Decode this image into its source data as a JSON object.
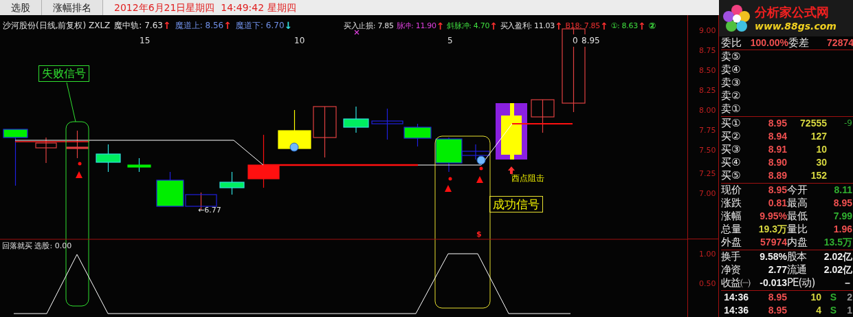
{
  "top_bar": {
    "tabs": [
      {
        "label": "选股",
        "selected": false
      },
      {
        "label": "涨幅排名",
        "selected": false
      }
    ],
    "datetime": "2012年6月21日星期四  14:49:42 星期四"
  },
  "logo": {
    "title": "分析家公式网",
    "url": "www.88gs.com"
  },
  "chart": {
    "header_left": [
      {
        "label": "沙河股份(日线,前复权) ZXLZ",
        "color": "#e0e0e0"
      },
      {
        "label": "魔中轨:",
        "value": "7.63",
        "color": "#e0e0e0",
        "arrow": {
          "text": "↑",
          "color": "#ff3030"
        }
      },
      {
        "label": "魔道上:",
        "value": "8.56",
        "color": "#7090e8",
        "arrow": {
          "text": "↑",
          "color": "#ff3030"
        }
      },
      {
        "label": "魔道下:",
        "value": "6.70",
        "color": "#7090e8",
        "arrow": {
          "text": "↓",
          "color": "#30e0e0"
        }
      }
    ],
    "header_right": [
      {
        "label": "买入止损:",
        "value": "7.85",
        "color": "#e0e0e0"
      },
      {
        "label": "脉冲:",
        "value": "11.90",
        "color": "#e040e0",
        "arrow": {
          "text": "↑",
          "color": "#ff3030"
        }
      },
      {
        "label": "斜脉冲:",
        "value": "4.70",
        "color": "#40e040",
        "arrow": {
          "text": "↑",
          "color": "#ff3030"
        }
      },
      {
        "label": "买入盈利:",
        "value": "11.03",
        "color": "#e0e0e0",
        "arrow": {
          "text": "↑",
          "color": "#ff3030"
        }
      },
      {
        "label": "B18:",
        "value": "7.85",
        "color": "#f03030",
        "arrow": {
          "text": "↑",
          "color": "#ff3030"
        }
      },
      {
        "label": "①:",
        "value": "8.63",
        "color": "#40e040",
        "arrow": {
          "text": "↑",
          "color": "#ff3030"
        }
      },
      {
        "label": "②",
        "color": "#40e040"
      }
    ],
    "x_labels": [
      "15",
      "10",
      "5",
      "0"
    ],
    "last_price": "8.95",
    "low_label": "←6.77",
    "fail_signal": "失败信号",
    "success_signal": "成功信号",
    "resistance_label": "西点阻击",
    "sell_mark": "$",
    "price_axis": [
      "9.00",
      "8.75",
      "8.50",
      "8.25",
      "8.00",
      "7.75",
      "7.50",
      "7.25",
      "7.00"
    ],
    "indicator_title": "回落就买 选股: 0.00",
    "indicator_axis": [
      "1.00",
      "0.50"
    ]
  },
  "quote_panel": {
    "order_ratio": [
      {
        "label": "委比",
        "value": "100.00%",
        "color": "#f05050"
      },
      {
        "label": "委差",
        "value": "72874",
        "color": "#f05050"
      }
    ],
    "asks": [
      {
        "label": "卖⑤"
      },
      {
        "label": "卖④"
      },
      {
        "label": "卖③"
      },
      {
        "label": "卖②"
      },
      {
        "label": "卖①"
      }
    ],
    "bids": [
      {
        "label": "买①",
        "price": "8.95",
        "volume": "72555",
        "change": "-9"
      },
      {
        "label": "买②",
        "price": "8.94",
        "volume": "127"
      },
      {
        "label": "买③",
        "price": "8.91",
        "volume": "10"
      },
      {
        "label": "买④",
        "price": "8.90",
        "volume": "30"
      },
      {
        "label": "买⑤",
        "price": "8.89",
        "volume": "152"
      }
    ],
    "quote_rows": [
      [
        {
          "label": "现价",
          "value": "8.95",
          "color": "#f05050"
        },
        {
          "label": "今开",
          "value": "8.11",
          "color": "#30b030"
        }
      ],
      [
        {
          "label": "涨跌",
          "value": "0.81",
          "color": "#f05050"
        },
        {
          "label": "最高",
          "value": "8.95",
          "color": "#f05050"
        }
      ],
      [
        {
          "label": "涨幅",
          "value": "9.95%",
          "color": "#f05050"
        },
        {
          "label": "最低",
          "value": "7.99",
          "color": "#30b030"
        }
      ],
      [
        {
          "label": "总量",
          "value": "19.3万",
          "color": "#d8d840"
        },
        {
          "label": "量比",
          "value": "1.96",
          "color": "#f05050"
        }
      ],
      [
        {
          "label": "外盘",
          "value": "57974",
          "color": "#f05050"
        },
        {
          "label": "内盘",
          "value": "13.5万",
          "color": "#30b030"
        }
      ]
    ],
    "fundamental_rows": [
      [
        {
          "label": "换手",
          "value": "9.58%"
        },
        {
          "label": "股本",
          "value": "2.02亿"
        }
      ],
      [
        {
          "label": "净资",
          "value": "2.77"
        },
        {
          "label": "流通",
          "value": "2.02亿"
        }
      ],
      [
        {
          "label": "收益㈠",
          "value": "-0.013"
        },
        {
          "label": "PE(动)",
          "value": "－"
        }
      ]
    ],
    "trades": [
      {
        "time": "14:36",
        "price": "8.95",
        "volume": "10",
        "side": "S",
        "extra": "2"
      },
      {
        "time": "14:36",
        "price": "8.95",
        "volume": "4",
        "side": "S",
        "extra": "1"
      }
    ]
  }
}
